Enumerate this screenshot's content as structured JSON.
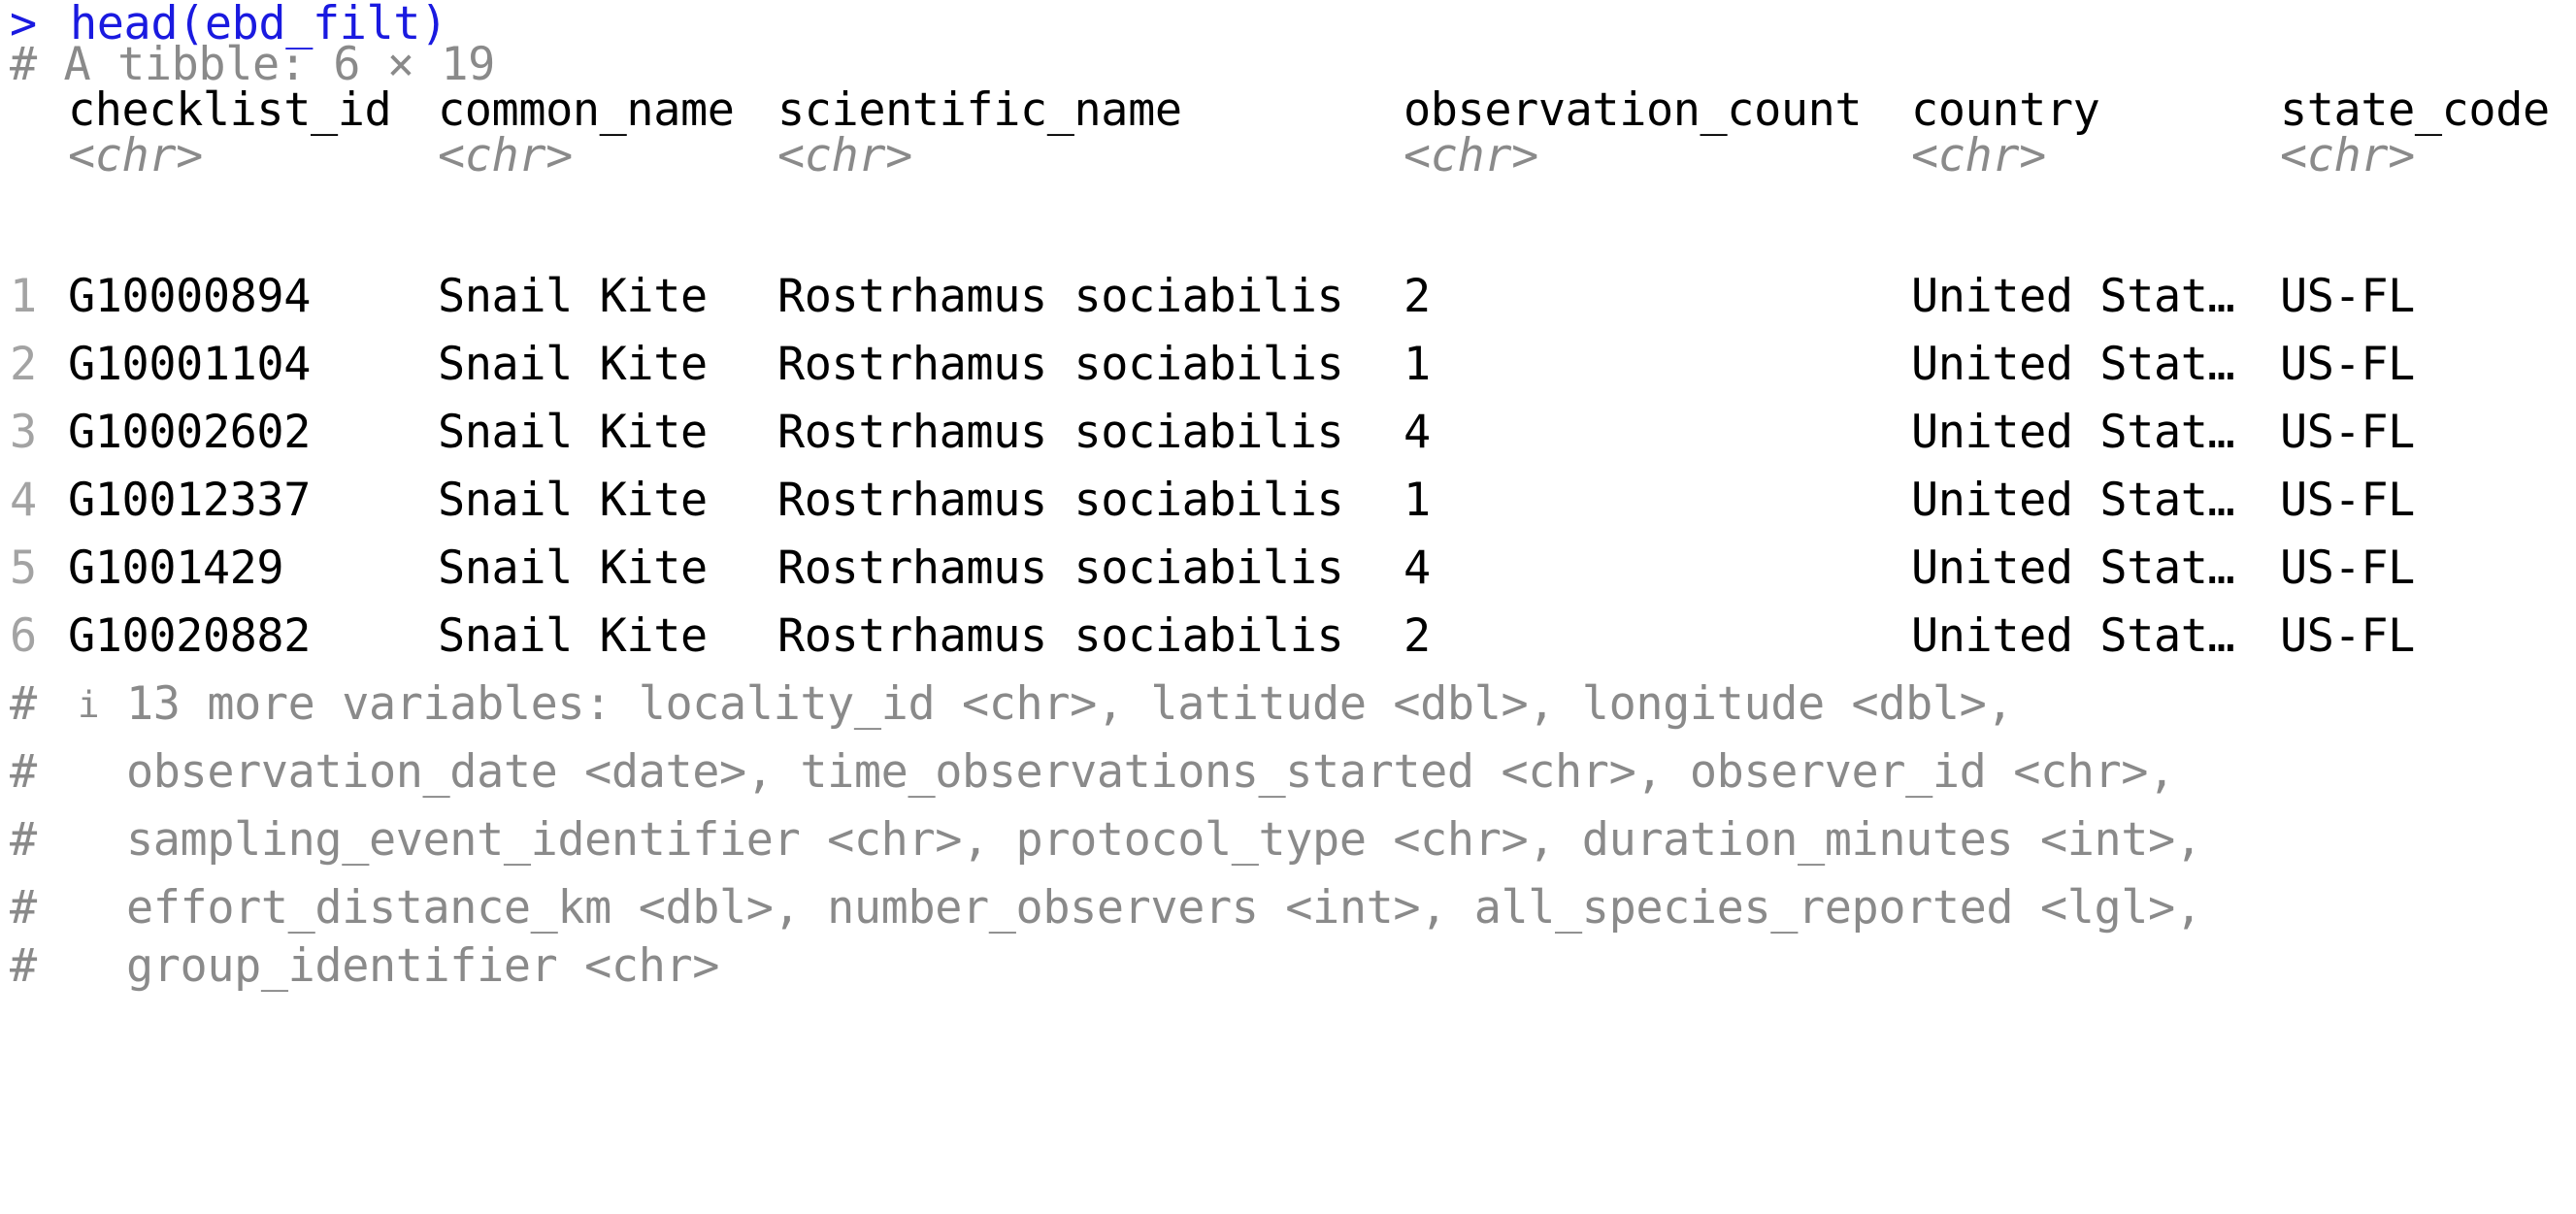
{
  "command": {
    "prompt": ">",
    "text": "head(ebd_filt)"
  },
  "summary": "# A tibble: 6 × 19",
  "columns": [
    {
      "name": "checklist_id",
      "type": "<chr>"
    },
    {
      "name": "common_name",
      "type": "<chr>"
    },
    {
      "name": "scientific_name",
      "type": "<chr>"
    },
    {
      "name": "observation_count",
      "type": "<chr>"
    },
    {
      "name": "country",
      "type": "<chr>"
    },
    {
      "name": "state_code",
      "type": "<chr>"
    }
  ],
  "rows": [
    {
      "n": "1",
      "cells": [
        "G10000894",
        "Snail Kite",
        "Rostrhamus sociabilis",
        "2",
        "United Stat…",
        "US-FL"
      ]
    },
    {
      "n": "2",
      "cells": [
        "G10001104",
        "Snail Kite",
        "Rostrhamus sociabilis",
        "1",
        "United Stat…",
        "US-FL"
      ]
    },
    {
      "n": "3",
      "cells": [
        "G10002602",
        "Snail Kite",
        "Rostrhamus sociabilis",
        "4",
        "United Stat…",
        "US-FL"
      ]
    },
    {
      "n": "4",
      "cells": [
        "G10012337",
        "Snail Kite",
        "Rostrhamus sociabilis",
        "1",
        "United Stat…",
        "US-FL"
      ]
    },
    {
      "n": "5",
      "cells": [
        "G1001429",
        "Snail Kite",
        "Rostrhamus sociabilis",
        "4",
        "United Stat…",
        "US-FL"
      ]
    },
    {
      "n": "6",
      "cells": [
        "G10020882",
        "Snail Kite",
        "Rostrhamus sociabilis",
        "2",
        "United Stat…",
        "US-FL"
      ]
    }
  ],
  "footer": {
    "hash": "#",
    "info_icon": "i",
    "lines": [
      "13 more variables: locality_id <chr>, latitude <dbl>, longitude <dbl>,",
      "observation_date <date>, time_observations_started <chr>, observer_id <chr>,",
      "sampling_event_identifier <chr>, protocol_type <chr>, duration_minutes <int>,",
      "effort_distance_km <dbl>, number_observers <int>, all_species_reported <lgl>,",
      "group_identifier <chr>"
    ]
  },
  "colors": {
    "command": "#1a1ae0",
    "comment": "#8a8a8a",
    "text": "#000000",
    "background": "#ffffff"
  }
}
